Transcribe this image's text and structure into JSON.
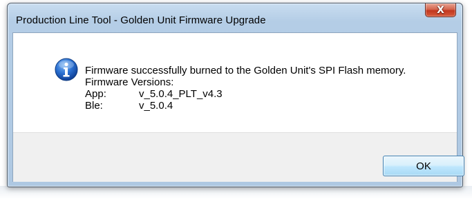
{
  "window": {
    "title": "Production Line Tool - Golden Unit Firmware Upgrade",
    "close_symbol": "X"
  },
  "dialog": {
    "icon": "information-icon",
    "message": "Firmware successfully burned to the Golden Unit's SPI Flash memory.",
    "versions_heading": "Firmware Versions:",
    "versions": [
      {
        "label": "App:",
        "value": "v_5.0.4_PLT_v4.3"
      },
      {
        "label": "Ble:",
        "value": "v_5.0.4"
      }
    ],
    "ok_label": "OK"
  },
  "colors": {
    "titlebar": "#b9d1ea",
    "close_button": "#c7442b",
    "ok_button_border": "#3c7fb1",
    "button_area": "#f0f0f0",
    "info_icon": "#1f64c4"
  }
}
